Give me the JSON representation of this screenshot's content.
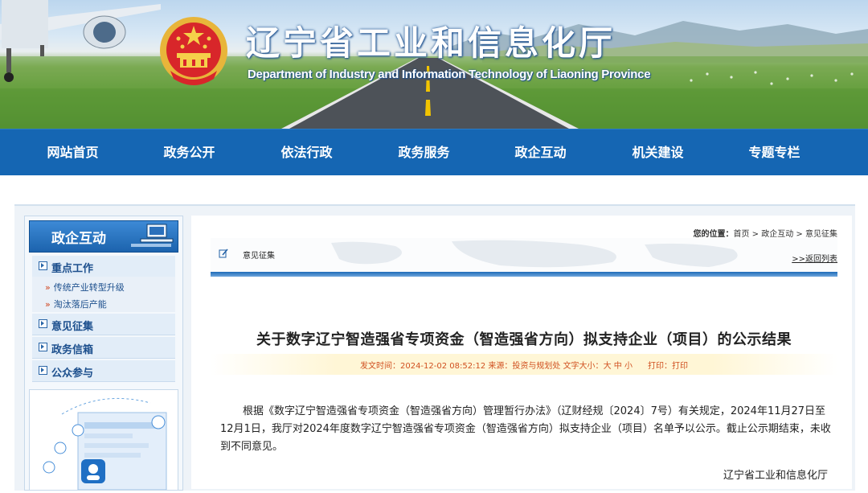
{
  "header": {
    "title": "辽宁省工业和信息化厅",
    "subtitle": "Department of Industry and Information Technology of Liaoning Province"
  },
  "nav": {
    "items": [
      "网站首页",
      "政务公开",
      "依法行政",
      "政务服务",
      "政企互动",
      "机关建设",
      "专题专栏"
    ]
  },
  "sidebar": {
    "heading": "政企互动",
    "items": [
      {
        "label": "重点工作"
      },
      {
        "label": "意见征集"
      },
      {
        "label": "政务信箱"
      },
      {
        "label": "公众参与"
      }
    ],
    "subitems": [
      "传统产业转型升级",
      "淘汰落后产能"
    ]
  },
  "breadcrumb": {
    "prefix": "您的位置：",
    "home": "首页",
    "sep1": " > ",
    "section": "政企互动",
    "sep2": " > ",
    "current": "意见征集"
  },
  "tab": {
    "label": "意见征集"
  },
  "back_link": ">>返回列表",
  "article": {
    "title": "关于数字辽宁智造强省专项资金（智造强省方向）拟支持企业（项目）的公示结果",
    "meta_time": "发文时间：2024-12-02 08:52:12 ",
    "meta_source": "来源：投资与规划处 ",
    "meta_fontsize_label": "文字大小：",
    "meta_sizes": [
      "大",
      "中",
      "小"
    ],
    "meta_print_label": "打印：",
    "meta_print_link": "打印",
    "body": "根据《数字辽宁智造强省专项资金（智造强省方向）管理暂行办法》（辽财经规〔2024〕7号）有关规定，2024年11月27日至12月1日，我厅对2024年度数字辽宁智造强省专项资金（智造强省方向）拟支持企业（项目）名单予以公示。截止公示期结束，未收到不同意见。",
    "signature": "辽宁省工业和信息化厅"
  },
  "colors": {
    "nav_bg": "#1566b3",
    "accent_orange": "#d05020",
    "link_blue": "#1c4f8d"
  }
}
